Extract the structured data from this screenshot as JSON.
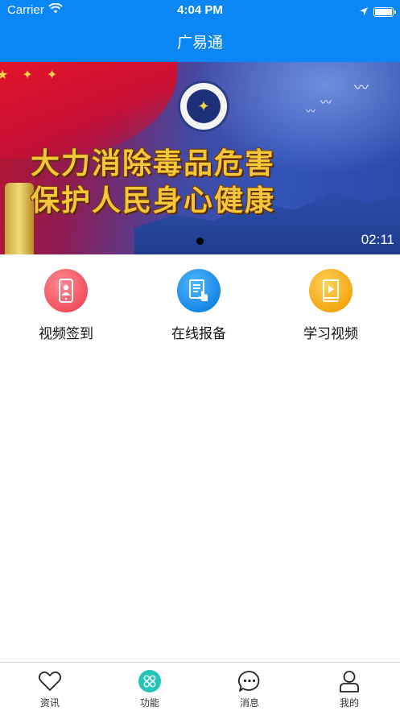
{
  "status_bar": {
    "carrier": "Carrier",
    "time": "4:04 PM",
    "icons": [
      "wifi-icon",
      "location-arrow-icon",
      "battery-icon"
    ]
  },
  "header": {
    "title": "广易通",
    "color": "#0b86f5"
  },
  "banner": {
    "slogan_line1": "大力消除毒品危害",
    "slogan_line2": "保护人民身心健康",
    "duration": "02:11"
  },
  "features": [
    {
      "label": "视频签到",
      "icon": "phone-user-icon",
      "color": "#f0525f"
    },
    {
      "label": "在线报备",
      "icon": "document-touch-icon",
      "color": "#1787e6"
    },
    {
      "label": "学习视频",
      "icon": "video-book-icon",
      "color": "#f4a614"
    }
  ],
  "tabbar": {
    "active_color": "#23c5b6",
    "tabs": [
      {
        "label": "资讯",
        "icon": "heart-icon"
      },
      {
        "label": "功能",
        "icon": "grid-icon",
        "active": true
      },
      {
        "label": "消息",
        "icon": "chat-bubble-icon"
      },
      {
        "label": "我的",
        "icon": "person-icon"
      }
    ]
  }
}
